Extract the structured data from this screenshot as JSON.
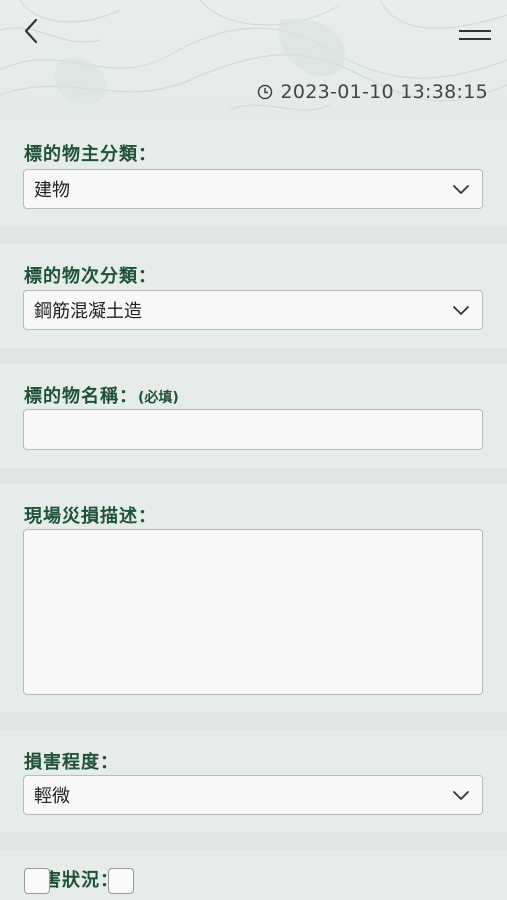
{
  "header": {
    "timestamp": "2023-01-10 13:38:15"
  },
  "form": {
    "main_category": {
      "label": "標的物主分類：",
      "value": "建物"
    },
    "sub_category": {
      "label": "標的物次分類：",
      "value": "鋼筋混凝土造"
    },
    "name": {
      "label": "標的物名稱：",
      "required_note": "(必填)",
      "value": ""
    },
    "description": {
      "label": "現場災損描述：",
      "value": ""
    },
    "damage_level": {
      "label": "損害程度：",
      "value": "輕微"
    },
    "damage_status": {
      "label": "損害狀況："
    }
  }
}
